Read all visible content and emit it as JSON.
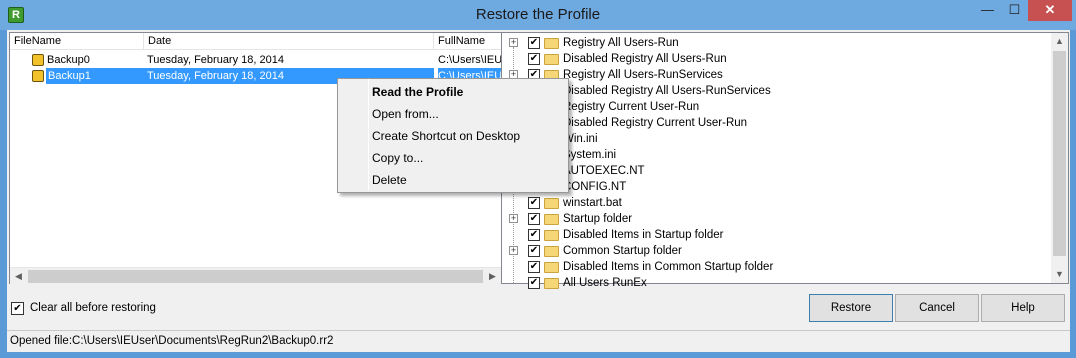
{
  "window": {
    "title": "Restore the Profile",
    "app_icon_letter": "R",
    "minimize_glyph": "—",
    "maximize_glyph": "☐",
    "close_glyph": "✕"
  },
  "list": {
    "columns": [
      "FileName",
      "Date",
      "FullName"
    ],
    "rows": [
      {
        "name": "Backup0",
        "date": "Tuesday, February 18, 2014",
        "full": "C:\\Users\\IEUser"
      },
      {
        "name": "Backup1",
        "date": "Tuesday, February 18, 2014",
        "full": "C:\\Users\\IEUser"
      }
    ],
    "selected_row": 1
  },
  "tree": {
    "items": [
      {
        "label": "Registry All Users-Run",
        "expandable": true,
        "checked": true
      },
      {
        "label": "Disabled Registry All Users-Run",
        "expandable": false,
        "checked": true
      },
      {
        "label": "Registry All Users-RunServices",
        "expandable": true,
        "checked": true
      },
      {
        "label": "Disabled Registry All Users-RunServices",
        "expandable": false,
        "checked": true
      },
      {
        "label": "Registry Current User-Run",
        "expandable": false,
        "checked": true
      },
      {
        "label": "Disabled Registry Current User-Run",
        "expandable": false,
        "checked": true
      },
      {
        "label": "Win.ini",
        "expandable": false,
        "checked": true
      },
      {
        "label": "System.ini",
        "expandable": false,
        "checked": true
      },
      {
        "label": "AUTOEXEC.NT",
        "expandable": false,
        "checked": true
      },
      {
        "label": "CONFIG.NT",
        "expandable": false,
        "checked": true
      },
      {
        "label": "winstart.bat",
        "expandable": false,
        "checked": true
      },
      {
        "label": "Startup folder",
        "expandable": true,
        "checked": true
      },
      {
        "label": "Disabled Items in Startup folder",
        "expandable": false,
        "checked": true
      },
      {
        "label": "Common Startup folder",
        "expandable": true,
        "checked": true
      },
      {
        "label": "Disabled Items in Common Startup folder",
        "expandable": false,
        "checked": true
      },
      {
        "label": "All Users RunEx",
        "expandable": false,
        "checked": true
      }
    ]
  },
  "context_menu": {
    "items": [
      "Read the Profile",
      "Open from...",
      "Create Shortcut on Desktop",
      "Copy to...",
      "Delete"
    ]
  },
  "options": {
    "clear_all_label": "Clear all before restoring",
    "clear_all_checked": true
  },
  "buttons": {
    "restore": "Restore",
    "cancel": "Cancel",
    "help": "Help"
  },
  "status": {
    "text": "Opened file:C:\\Users\\IEUser\\Documents\\RegRun2\\Backup0.rr2"
  },
  "colors": {
    "selection": "#3399ff",
    "titlebar": "#6ea9e0",
    "close_button": "#c75050"
  }
}
